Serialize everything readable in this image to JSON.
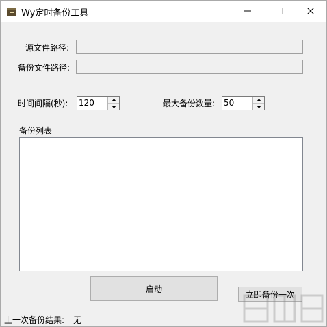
{
  "window": {
    "title": "Wy定时备份工具"
  },
  "form": {
    "source_label": "源文件路径:",
    "source_value": "",
    "backup_label": "备份文件路径:",
    "backup_value": "",
    "interval_label": "时间间隔(秒):",
    "interval_value": "120",
    "max_label": "最大备份数量:",
    "max_value": "50",
    "list_label": "备份列表"
  },
  "list": {
    "items": []
  },
  "buttons": {
    "start": "启动",
    "backup_now": "立即备份一次"
  },
  "status": {
    "label": "上一次备份结果:",
    "value": "无"
  },
  "icons": {
    "app": "folder-icon",
    "minimize": "minimize-icon",
    "maximize": "maximize-icon",
    "close": "close-icon",
    "spin_up": "arrow-up-icon",
    "spin_down": "arrow-down-icon"
  }
}
